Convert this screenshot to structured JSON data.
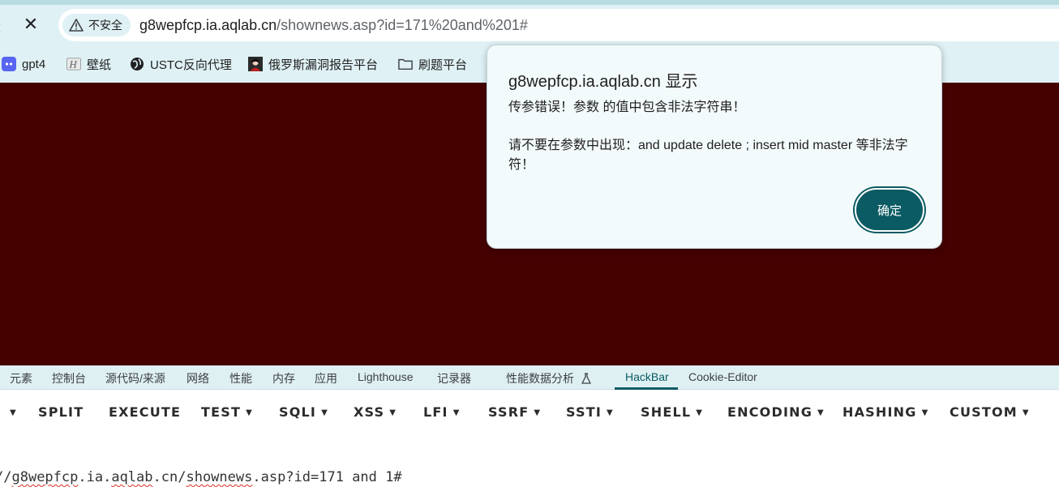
{
  "browser": {
    "security_label": "不安全",
    "url_host": "g8wepfcp.ia.aqlab.cn",
    "url_path": "/shownews.asp?id=171%20and%201#"
  },
  "bookmarks": [
    {
      "label": "gpt4",
      "icon": "discord-like-icon"
    },
    {
      "label": "壁纸",
      "icon": "wallpaper-icon"
    },
    {
      "label": "USTC反向代理",
      "icon": "globe-icon"
    },
    {
      "label": "俄罗斯漏洞报告平台",
      "icon": "avatar-icon"
    },
    {
      "label": "刷题平台",
      "icon": "folder-icon"
    }
  ],
  "dialog": {
    "title": "g8wepfcp.ia.aqlab.cn 显示",
    "line1": "传参错误！参数  的值中包含非法字符串！",
    "line2": "请不要在参数中出现：and update delete ; insert mid master 等非法字符！",
    "ok_label": "确定"
  },
  "devtools": {
    "tabs": [
      "元素",
      "控制台",
      "源代码/来源",
      "网络",
      "性能",
      "内存",
      "应用",
      "Lighthouse",
      "记录器",
      "性能数据分析",
      "HackBar",
      "Cookie-Editor"
    ],
    "active_tab": "HackBar"
  },
  "hackbar": {
    "menu": [
      "SPLIT",
      "EXECUTE",
      "TEST",
      "SQLI",
      "XSS",
      "LFI",
      "SSRF",
      "SSTI",
      "SHELL",
      "ENCODING",
      "HASHING",
      "CUSTOM"
    ],
    "url_prefix": "//",
    "url_host": "g8wepfcp",
    "url_rest_1": ".ia.",
    "url_aqlab": "aqlab",
    "url_rest_2": ".cn/",
    "url_shownews": "shownews",
    "url_rest_3": ".asp?id=171 and 1#"
  },
  "colors": {
    "page_background": "#450000",
    "accent": "#0a5b63",
    "chrome": "#dff1f4"
  }
}
